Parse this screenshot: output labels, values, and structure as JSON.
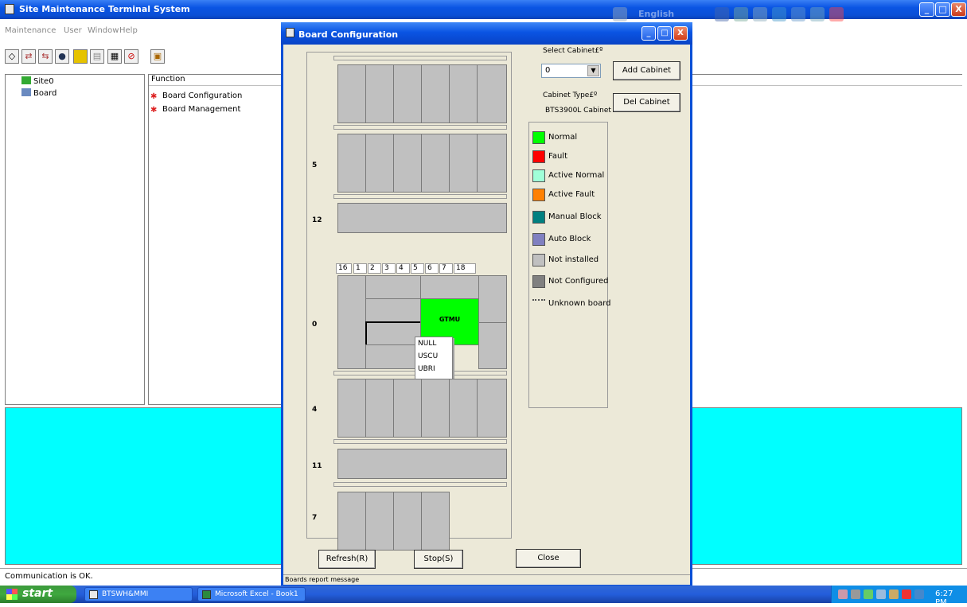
{
  "main_window": {
    "title": "Site Maintenance Terminal System",
    "faded_lang": "English",
    "controls": {
      "minimize": "_",
      "maximize": "□",
      "close": "X"
    }
  },
  "menu": {
    "items": [
      "Maintenance",
      "User",
      "Window",
      "Help"
    ]
  },
  "toolbar": {
    "icons": [
      "diamond-icon",
      "swap-icon",
      "arrows-icon",
      "globe-icon",
      "battery-icon",
      "document-icon",
      "printer-icon",
      "stop-icon",
      "export-icon"
    ]
  },
  "tree": {
    "items": [
      {
        "label": "Site0",
        "icon": "site-icon"
      },
      {
        "label": "Board",
        "icon": "board-icon"
      }
    ]
  },
  "function_panel": {
    "header": "Function",
    "items": [
      {
        "label": "Board Configuration"
      },
      {
        "label": "Board Management"
      }
    ]
  },
  "status": {
    "text": "Communication is OK."
  },
  "dialog": {
    "title": "Board Configuration",
    "row_labels": {
      "r5": "5",
      "r12": "12",
      "r0": "0",
      "r4": "4",
      "r11": "11",
      "r7": "7"
    },
    "slot_numbers": [
      "16",
      "1",
      "2",
      "3",
      "4",
      "5",
      "6",
      "7",
      "18"
    ],
    "gtmu_label": "GTMU",
    "context_menu": [
      "NULL",
      "USCU",
      "UBRI"
    ],
    "select_cabinet_label": "Select Cabinet£º",
    "select_cabinet_value": "0",
    "add_cabinet": "Add Cabinet",
    "del_cabinet": "Del Cabinet",
    "cabinet_type_label": "Cabinet Type£º",
    "cabinet_type_value": "BTS3900L Cabinet",
    "legend": [
      {
        "label": "Normal",
        "color": "#00ff00"
      },
      {
        "label": "Fault",
        "color": "#ff0000"
      },
      {
        "label": "Active Normal",
        "color": "#a0ffd8"
      },
      {
        "label": "Active Fault",
        "color": "#ff8000"
      },
      {
        "label": "Manual Block",
        "color": "#008080"
      },
      {
        "label": "Auto Block",
        "color": "#8080c0"
      },
      {
        "label": "Not installed",
        "color": "#c0c0c0"
      },
      {
        "label": "Not Configured",
        "color": "#808080"
      },
      {
        "label": "Unknown board",
        "color": "none"
      }
    ],
    "refresh": "Refresh(R)",
    "stop": "Stop(S)",
    "close": "Close",
    "footer_text": "Boards report message"
  },
  "taskbar": {
    "start": "start",
    "tasks": [
      "BTSWH&MMI",
      "Microsoft Excel - Book1"
    ],
    "time": "6:27 PM"
  }
}
